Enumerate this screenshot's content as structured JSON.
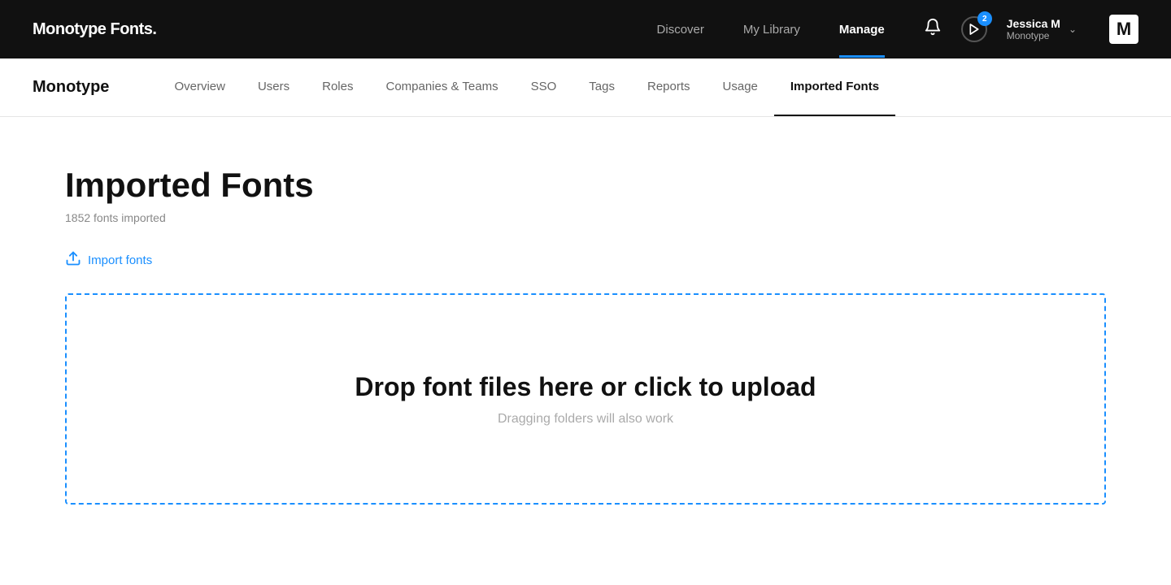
{
  "topNav": {
    "logo": "Monotype Fonts.",
    "links": [
      {
        "id": "discover",
        "label": "Discover",
        "active": false
      },
      {
        "id": "my-library",
        "label": "My Library",
        "active": false
      },
      {
        "id": "manage",
        "label": "Manage",
        "active": true
      }
    ],
    "badge": "2",
    "user": {
      "name": "Jessica M",
      "org": "Monotype"
    },
    "mLogo": "M"
  },
  "secondaryNav": {
    "logo": "Monotype",
    "links": [
      {
        "id": "overview",
        "label": "Overview",
        "active": false
      },
      {
        "id": "users",
        "label": "Users",
        "active": false
      },
      {
        "id": "roles",
        "label": "Roles",
        "active": false
      },
      {
        "id": "companies-teams",
        "label": "Companies & Teams",
        "active": false
      },
      {
        "id": "sso",
        "label": "SSO",
        "active": false
      },
      {
        "id": "tags",
        "label": "Tags",
        "active": false
      },
      {
        "id": "reports",
        "label": "Reports",
        "active": false
      },
      {
        "id": "usage",
        "label": "Usage",
        "active": false
      },
      {
        "id": "imported-fonts",
        "label": "Imported Fonts",
        "active": true
      }
    ]
  },
  "page": {
    "title": "Imported Fonts",
    "subtitle": "1852 fonts imported",
    "importButton": "Import fonts",
    "dropZone": {
      "title": "Drop font files here or click to upload",
      "subtitle": "Dragging folders will also work"
    }
  }
}
